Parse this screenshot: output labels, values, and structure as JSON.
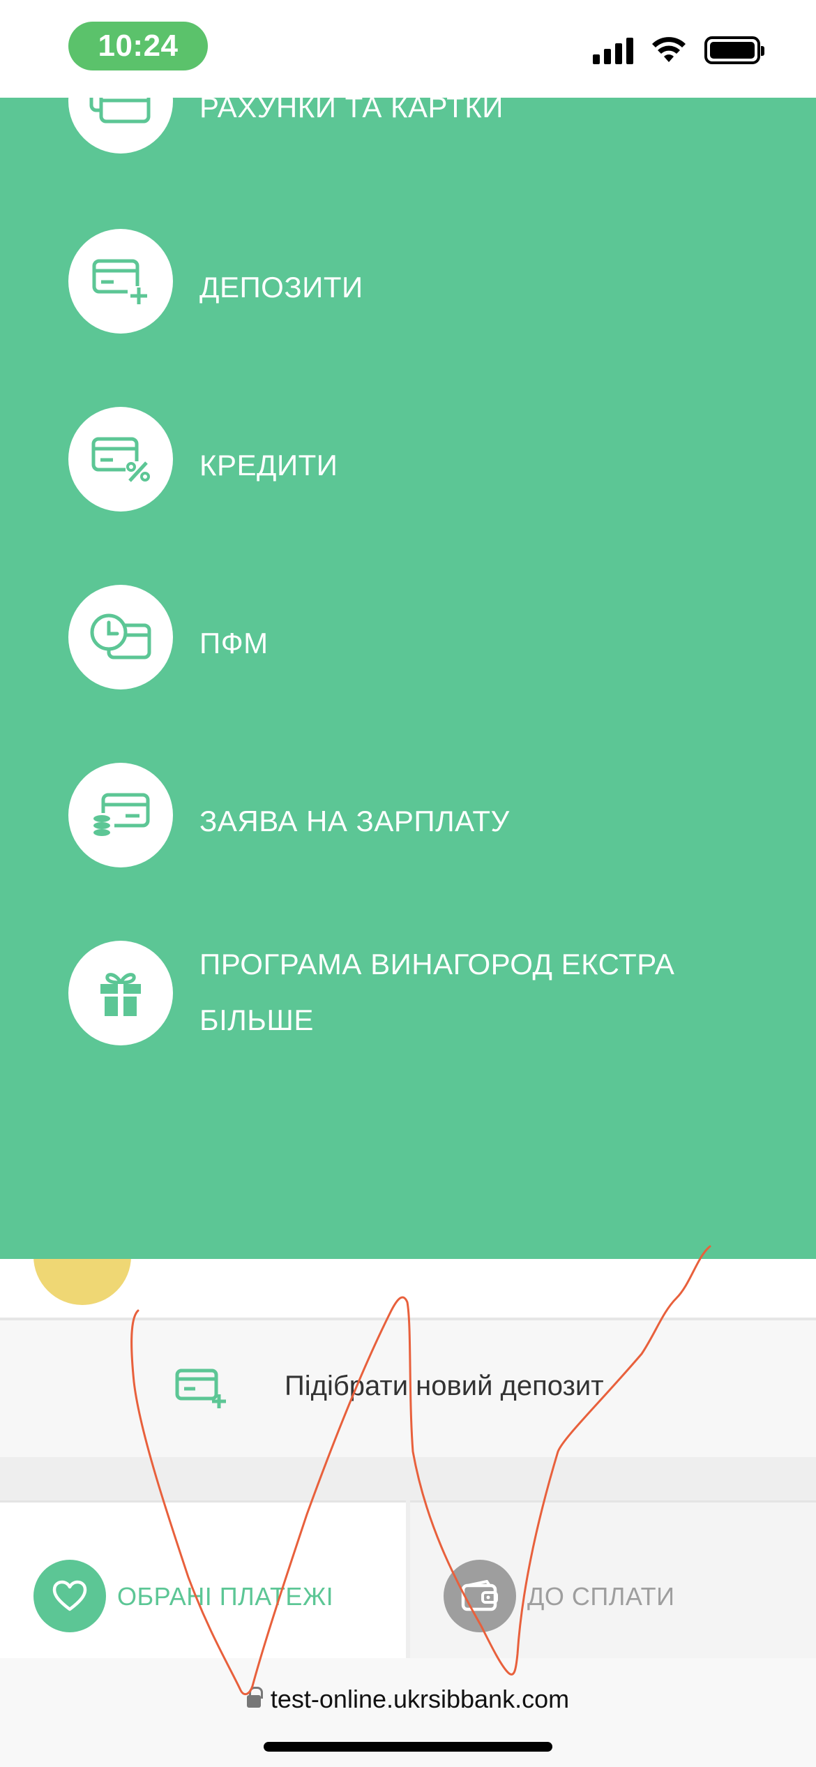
{
  "status_bar": {
    "time": "10:24"
  },
  "menu": {
    "items": [
      {
        "label": "РАХУНКИ ТА КАРТКИ",
        "icon": "cards-icon"
      },
      {
        "label": "ДЕПОЗИТИ",
        "icon": "card-plus-icon"
      },
      {
        "label": "КРЕДИТИ",
        "icon": "card-percent-icon"
      },
      {
        "label": "ПФМ",
        "icon": "clock-card-icon"
      },
      {
        "label": "ЗАЯВА НА ЗАРПЛАТУ",
        "icon": "card-coins-icon"
      },
      {
        "label_line1": "ПРОГРАМА ВИНАГОРОД ЕКСТРА",
        "label_line2": "БІЛЬШЕ",
        "icon": "gift-icon"
      }
    ],
    "background_color": "#5cc695"
  },
  "content": {
    "new_deposit_label": "Підібрати новий депозит",
    "new_deposit_icon": "card-plus-icon"
  },
  "bottom_tabs": {
    "favorites": {
      "label": "ОБРАНІ ПЛАТЕЖІ",
      "icon": "heart-icon",
      "color": "#5cc695"
    },
    "to_pay": {
      "label": "ДО СПЛАТИ",
      "icon": "wallet-icon",
      "color": "#9e9e9e"
    }
  },
  "browser": {
    "url": "test-online.ukrsibbank.com"
  },
  "accent_color": "#5cc695",
  "annotation_color": "#e8603c"
}
